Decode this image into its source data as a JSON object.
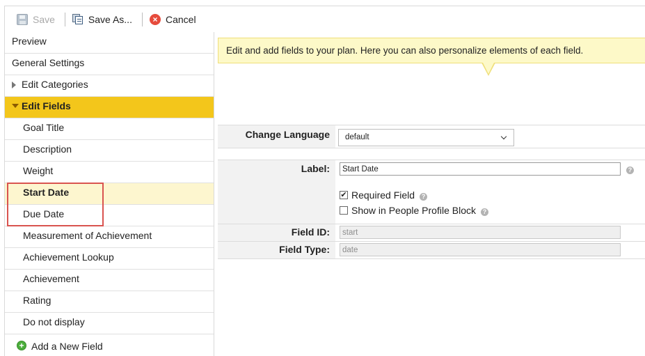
{
  "toolbar": {
    "save_label": "Save",
    "save_as_label": "Save As...",
    "cancel_label": "Cancel",
    "cancel_icon": "×"
  },
  "nav": {
    "items": [
      {
        "label": "Preview"
      },
      {
        "label": "General Settings"
      },
      {
        "label": "Edit Categories"
      },
      {
        "label": "Edit Fields"
      }
    ],
    "fields": [
      {
        "label": "Goal Title"
      },
      {
        "label": "Description"
      },
      {
        "label": "Weight"
      },
      {
        "label": "Start Date"
      },
      {
        "label": "Due Date"
      },
      {
        "label": "Measurement of Achievement"
      },
      {
        "label": "Achievement Lookup"
      },
      {
        "label": "Achievement"
      },
      {
        "label": "Rating"
      },
      {
        "label": "Do not display"
      }
    ],
    "add_field_label": "Add a New Field",
    "add_icon": "+"
  },
  "tip": {
    "text": "Edit and add fields to your plan. Here you can also personalize elements of each field."
  },
  "form": {
    "change_language_label": "Change Language",
    "language_value": "default",
    "label_label": "Label:",
    "label_value": "Start Date",
    "required_label": "Required Field",
    "required_checked": true,
    "profile_label": "Show in People Profile Block",
    "profile_checked": false,
    "field_id_label": "Field ID:",
    "field_id_value": "start",
    "field_type_label": "Field Type:",
    "field_type_value": "date",
    "help_glyph": "?",
    "check_glyph": "✔"
  },
  "colors": {
    "active_category": "#f3c61b",
    "selected_field": "#fdf6cf",
    "tip_background": "#fdf9c8",
    "highlight_box": "#d9534f"
  }
}
